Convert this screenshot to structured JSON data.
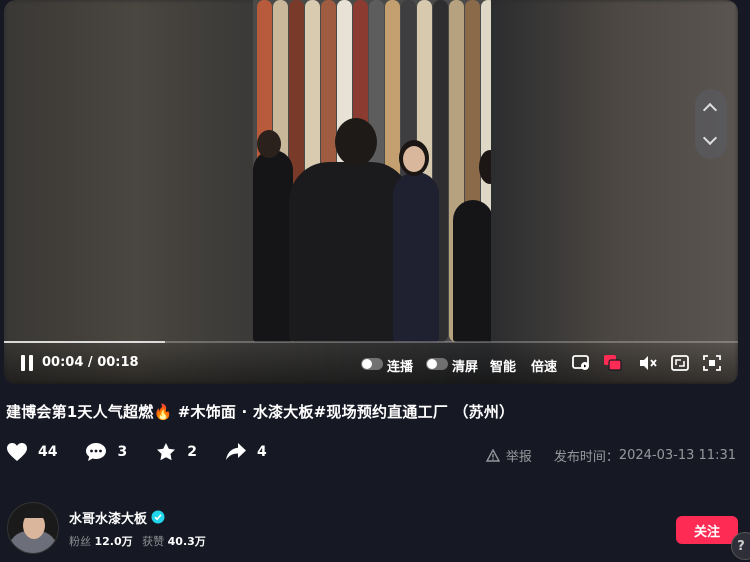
{
  "player": {
    "current_time": "00:04",
    "duration": "00:18",
    "progress": 0.22,
    "controls": {
      "lianbo": "连播",
      "qingping": "清屏",
      "zhineng": "智能",
      "beisu": "倍速"
    }
  },
  "video": {
    "title": "建博会第1天人气超燃🔥 #木饰面 · 水漆大板#现场预约直通工厂 （苏州）"
  },
  "actions": {
    "likes": "44",
    "comments": "3",
    "favorites": "2",
    "shares": "4",
    "report": "举报",
    "publish_label": "发布时间：",
    "publish_time": "2024-03-13 11:31"
  },
  "author": {
    "name": "水哥水漆大板",
    "fans_label": "粉丝",
    "fans": "12.0万",
    "likes_label": "获赞",
    "likes": "40.3万",
    "follow_label": "关注"
  },
  "colors": {
    "accent": "#fe2c55",
    "background": "#161823",
    "verified": "#20d5ec"
  }
}
